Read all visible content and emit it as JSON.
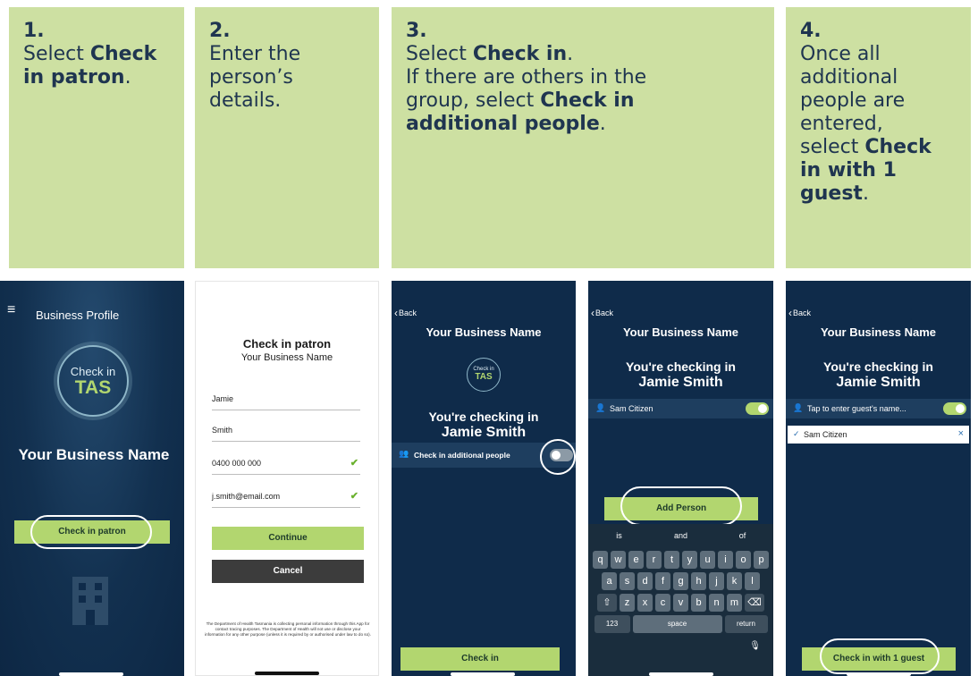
{
  "steps": [
    {
      "num": "1.",
      "lines": {
        "a": "Select ",
        "b": "Check in patron",
        "c": "."
      }
    },
    {
      "num": "2.",
      "text": "Enter the person’s details."
    },
    {
      "num": "3.",
      "a": "Select ",
      "b": "Check in",
      "c": ".",
      "d": "If there are others in the group, select ",
      "e": "Check in additional people",
      "f": "."
    },
    {
      "num": "4.",
      "a": "Once all additional people are entered, select ",
      "b": "Check in with 1 guest",
      "c": "."
    }
  ],
  "screen1": {
    "menu_icon": "≡",
    "title": "Business Profile",
    "logo_top": "Check in",
    "logo_bottom": "TAS",
    "business_name": "Your Business Name",
    "button": "Check in patron",
    "building_icon": "building-icon"
  },
  "screen2": {
    "title": "Check in patron",
    "subtitle": "Your Business Name",
    "first_name": "Jamie",
    "last_name": "Smith",
    "phone": "0400 000 000",
    "email": "j.smith@email.com",
    "continue": "Continue",
    "cancel": "Cancel",
    "disclaimer": "The Department of Health Tasmania is collecting personal information through this App for contact tracing purposes. The Department of Health will not use or disclose your information for any other purpose (unless it is required by or authorised under law to do so)."
  },
  "screen3": {
    "back": "Back",
    "title": "Your Business Name",
    "logo_top": "Check in",
    "logo_bottom": "TAS",
    "checking_label": "You're checking in",
    "name": "Jamie Smith",
    "additional_label": "Check in additional people",
    "button": "Check in"
  },
  "screen4": {
    "back": "Back",
    "title": "Your Business Name",
    "checking_label": "You're checking in",
    "name": "Jamie Smith",
    "person_input": "Sam Citizen",
    "add_person": "Add Person",
    "suggestions": [
      "is",
      "and",
      "of"
    ],
    "row1": [
      "q",
      "w",
      "e",
      "r",
      "t",
      "y",
      "u",
      "i",
      "o",
      "p"
    ],
    "row2": [
      "a",
      "s",
      "d",
      "f",
      "g",
      "h",
      "j",
      "k",
      "l"
    ],
    "row3": [
      "z",
      "x",
      "c",
      "v",
      "b",
      "n",
      "m"
    ],
    "shift": "⇧",
    "backspace": "⌫",
    "num_key": "123",
    "space_key": "space",
    "return_key": "return",
    "mic": "🎙"
  },
  "screen5": {
    "back": "Back",
    "title": "Your Business Name",
    "checking_label": "You're checking in",
    "name": "Jamie Smith",
    "guest_placeholder": "Tap to enter guest's name...",
    "guest_added": "Sam Citizen",
    "button": "Check in with 1 guest"
  },
  "colors": {
    "navy": "#0f2b4a",
    "card": "#cde0a2",
    "accent": "#b2d66f",
    "text_dark": "#1f3550"
  }
}
